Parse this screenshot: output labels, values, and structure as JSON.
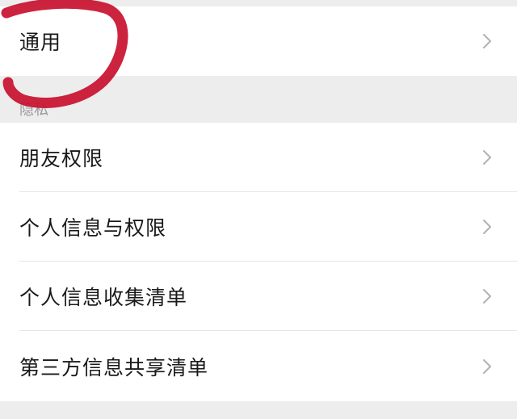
{
  "general": {
    "label": "通用"
  },
  "privacy": {
    "section_title": "隐私",
    "items": [
      {
        "label": "朋友权限"
      },
      {
        "label": "个人信息与权限"
      },
      {
        "label": "个人信息收集清单"
      },
      {
        "label": "第三方信息共享清单"
      }
    ]
  },
  "icons": {
    "chevron": "chevron-right-icon",
    "annotation": "red-marker-stroke"
  },
  "colors": {
    "background": "#ededed",
    "row_background": "#ffffff",
    "text": "#191919",
    "section_text": "#9a9a9a",
    "chevron": "#b2b2b2",
    "annotation": "#c8102e"
  }
}
